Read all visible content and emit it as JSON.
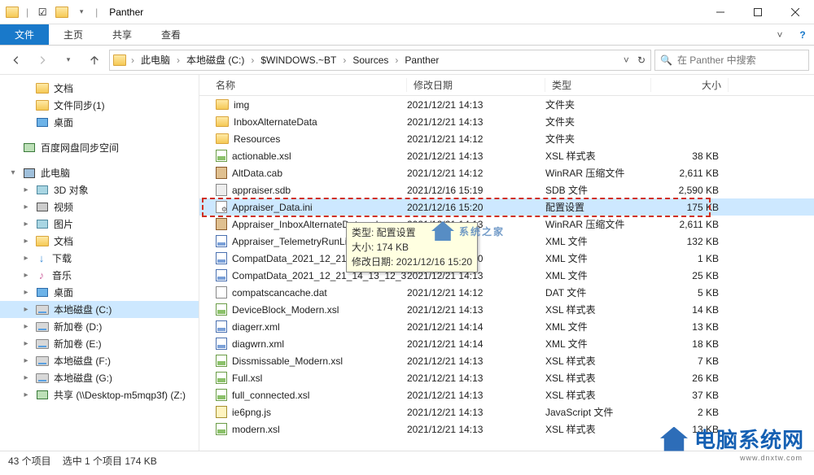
{
  "window": {
    "title": "Panther"
  },
  "ribbon": {
    "file": "文件",
    "tabs": [
      "主页",
      "共享",
      "查看"
    ]
  },
  "breadcrumb": [
    "此电脑",
    "本地磁盘 (C:)",
    "$WINDOWS.~BT",
    "Sources",
    "Panther"
  ],
  "search": {
    "placeholder": "在 Panther 中搜索"
  },
  "columns": {
    "name": "名称",
    "date": "修改日期",
    "type": "类型",
    "size": "大小"
  },
  "quick_access": [
    {
      "label": "文档",
      "icon": "folder"
    },
    {
      "label": "文件同步(1)",
      "icon": "folder"
    },
    {
      "label": "桌面",
      "icon": "monitor"
    }
  ],
  "cloud": {
    "label": "百度网盘同步空间",
    "icon": "net"
  },
  "this_pc": {
    "label": "此电脑",
    "children": [
      {
        "label": "3D 对象",
        "icon": "pic"
      },
      {
        "label": "视频",
        "icon": "vid"
      },
      {
        "label": "图片",
        "icon": "pic"
      },
      {
        "label": "文档",
        "icon": "folder"
      },
      {
        "label": "下载",
        "icon": "dl"
      },
      {
        "label": "音乐",
        "icon": "mus"
      },
      {
        "label": "桌面",
        "icon": "monitor"
      },
      {
        "label": "本地磁盘 (C:)",
        "icon": "drive",
        "selected": true
      },
      {
        "label": "新加卷 (D:)",
        "icon": "drive"
      },
      {
        "label": "新加卷 (E:)",
        "icon": "drive"
      },
      {
        "label": "本地磁盘 (F:)",
        "icon": "drive"
      },
      {
        "label": "本地磁盘 (G:)",
        "icon": "drive"
      },
      {
        "label": "共享 (\\\\Desktop-m5mqp3f) (Z:)",
        "icon": "net"
      }
    ]
  },
  "files": [
    {
      "name": "img",
      "date": "2021/12/21 14:13",
      "type": "文件夹",
      "size": "",
      "ico": "folder"
    },
    {
      "name": "InboxAlternateData",
      "date": "2021/12/21 14:13",
      "type": "文件夹",
      "size": "",
      "ico": "folder"
    },
    {
      "name": "Resources",
      "date": "2021/12/21 14:12",
      "type": "文件夹",
      "size": "",
      "ico": "folder"
    },
    {
      "name": "actionable.xsl",
      "date": "2021/12/21 14:13",
      "type": "XSL 样式表",
      "size": "38 KB",
      "ico": "xsl"
    },
    {
      "name": "AltData.cab",
      "date": "2021/12/21 14:12",
      "type": "WinRAR 压缩文件",
      "size": "2,611 KB",
      "ico": "cab"
    },
    {
      "name": "appraiser.sdb",
      "date": "2021/12/16 15:19",
      "type": "SDB 文件",
      "size": "2,590 KB",
      "ico": "sdb"
    },
    {
      "name": "Appraiser_Data.ini",
      "date": "2021/12/16 15:20",
      "type": "配置设置",
      "size": "175 KB",
      "ico": "ini",
      "selected": true
    },
    {
      "name": "Appraiser_InboxAlternateData.cab",
      "date": "2021/12/21 14:13",
      "type": "WinRAR 压缩文件",
      "size": "2,611 KB",
      "ico": "cab"
    },
    {
      "name": "Appraiser_TelemetryRunList.xml",
      "date": "",
      "type": "XML 文件",
      "size": "132 KB",
      "ico": "xml"
    },
    {
      "name": "CompatData_2021_12_21_14_13_08...",
      "date": "2021/12/16 15:20",
      "type": "XML 文件",
      "size": "1 KB",
      "ico": "xml"
    },
    {
      "name": "CompatData_2021_12_21_14_13_12_3...",
      "date": "2021/12/21 14:13",
      "type": "XML 文件",
      "size": "25 KB",
      "ico": "xml"
    },
    {
      "name": "compatscancache.dat",
      "date": "2021/12/21 14:12",
      "type": "DAT 文件",
      "size": "5 KB",
      "ico": "dat"
    },
    {
      "name": "DeviceBlock_Modern.xsl",
      "date": "2021/12/21 14:13",
      "type": "XSL 样式表",
      "size": "14 KB",
      "ico": "xsl"
    },
    {
      "name": "diagerr.xml",
      "date": "2021/12/21 14:14",
      "type": "XML 文件",
      "size": "13 KB",
      "ico": "xml"
    },
    {
      "name": "diagwrn.xml",
      "date": "2021/12/21 14:14",
      "type": "XML 文件",
      "size": "18 KB",
      "ico": "xml"
    },
    {
      "name": "Dissmissable_Modern.xsl",
      "date": "2021/12/21 14:13",
      "type": "XSL 样式表",
      "size": "7 KB",
      "ico": "xsl"
    },
    {
      "name": "Full.xsl",
      "date": "2021/12/21 14:13",
      "type": "XSL 样式表",
      "size": "26 KB",
      "ico": "xsl"
    },
    {
      "name": "full_connected.xsl",
      "date": "2021/12/21 14:13",
      "type": "XSL 样式表",
      "size": "37 KB",
      "ico": "xsl"
    },
    {
      "name": "ie6png.js",
      "date": "2021/12/21 14:13",
      "type": "JavaScript 文件",
      "size": "2 KB",
      "ico": "js"
    },
    {
      "name": "modern.xsl",
      "date": "2021/12/21 14:13",
      "type": "XSL 样式表",
      "size": "13 KB",
      "ico": "xsl"
    }
  ],
  "tooltip": {
    "line1": "类型: 配置设置",
    "line2": "大小: 174 KB",
    "line3": "修改日期: 2021/12/16 15:20"
  },
  "status": {
    "items": "43 个项目",
    "selected": "选中 1 个项目  174 KB"
  },
  "watermark": {
    "mid": "系统之家",
    "brand": "电脑系统网",
    "url": "www.dnxtw.com"
  }
}
